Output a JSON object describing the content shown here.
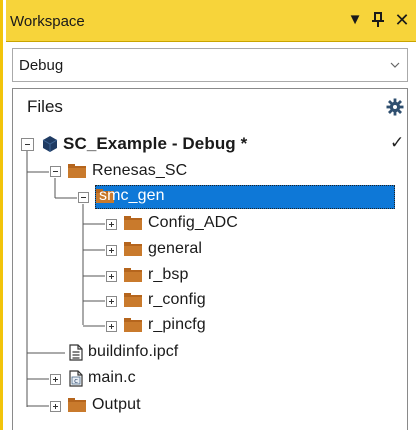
{
  "window": {
    "title": "Workspace",
    "dropdown_glyph": "▼",
    "pin_glyph": "ᵽ",
    "close_glyph": "✕"
  },
  "configuration": {
    "selected": "Debug"
  },
  "tree": {
    "header": "Files",
    "project": {
      "label": "SC_Example - Debug *",
      "active_mark": "✓"
    },
    "nodes": [
      {
        "label": "Renesas_SC",
        "icon": "folder-icon"
      },
      {
        "label": "smc_gen",
        "icon": "folder-icon",
        "selected": true
      },
      {
        "label": "Config_ADC",
        "icon": "folder-icon"
      },
      {
        "label": "general",
        "icon": "folder-icon"
      },
      {
        "label": "r_bsp",
        "icon": "folder-icon"
      },
      {
        "label": "r_config",
        "icon": "folder-icon"
      },
      {
        "label": "r_pincfg",
        "icon": "folder-icon"
      },
      {
        "label": "buildinfo.ipcf",
        "icon": "document-icon"
      },
      {
        "label": "main.c",
        "icon": "c-file-icon"
      },
      {
        "label": "Output",
        "icon": "folder-icon"
      }
    ]
  },
  "colors": {
    "title_bar": "#f7d43a",
    "selection": "#0e78d7",
    "folder": "#b5651d",
    "project_icon": "#1f3b63"
  }
}
